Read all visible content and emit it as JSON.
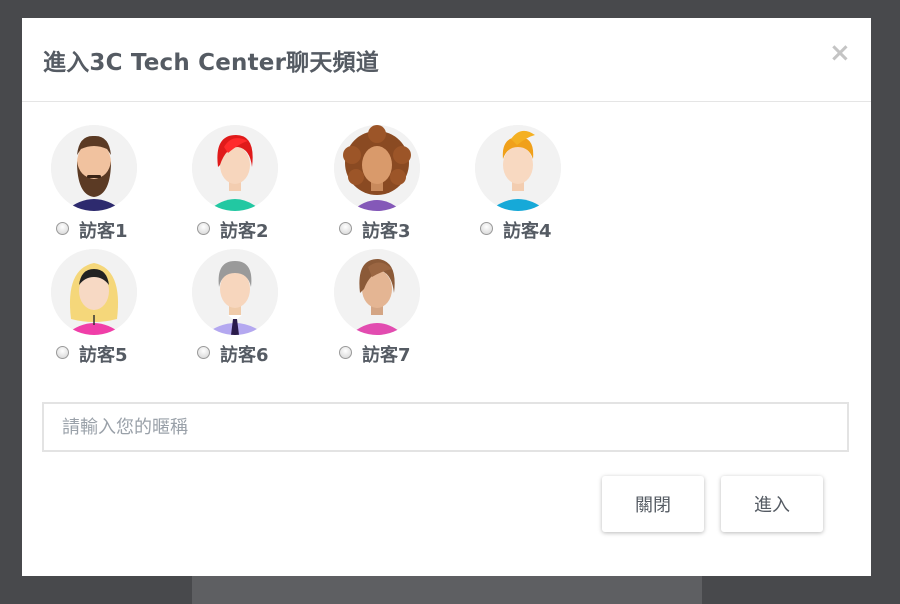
{
  "modal": {
    "title": "進入3C Tech Center聊天頻道",
    "close_symbol": "×"
  },
  "avatars": [
    {
      "label": "訪客1",
      "icon": "bearded-man-avatar-icon"
    },
    {
      "label": "訪客2",
      "icon": "red-hair-woman-avatar-icon"
    },
    {
      "label": "訪客3",
      "icon": "curly-hair-woman-avatar-icon"
    },
    {
      "label": "訪客4",
      "icon": "orange-hair-man-avatar-icon"
    },
    {
      "label": "訪客5",
      "icon": "hijab-woman-avatar-icon"
    },
    {
      "label": "訪客6",
      "icon": "gray-hair-man-avatar-icon"
    },
    {
      "label": "訪客7",
      "icon": "brown-hair-woman-avatar-icon"
    }
  ],
  "nickname": {
    "placeholder": "請輸入您的暱稱",
    "value": ""
  },
  "buttons": {
    "close_label": "關閉",
    "enter_label": "進入"
  }
}
